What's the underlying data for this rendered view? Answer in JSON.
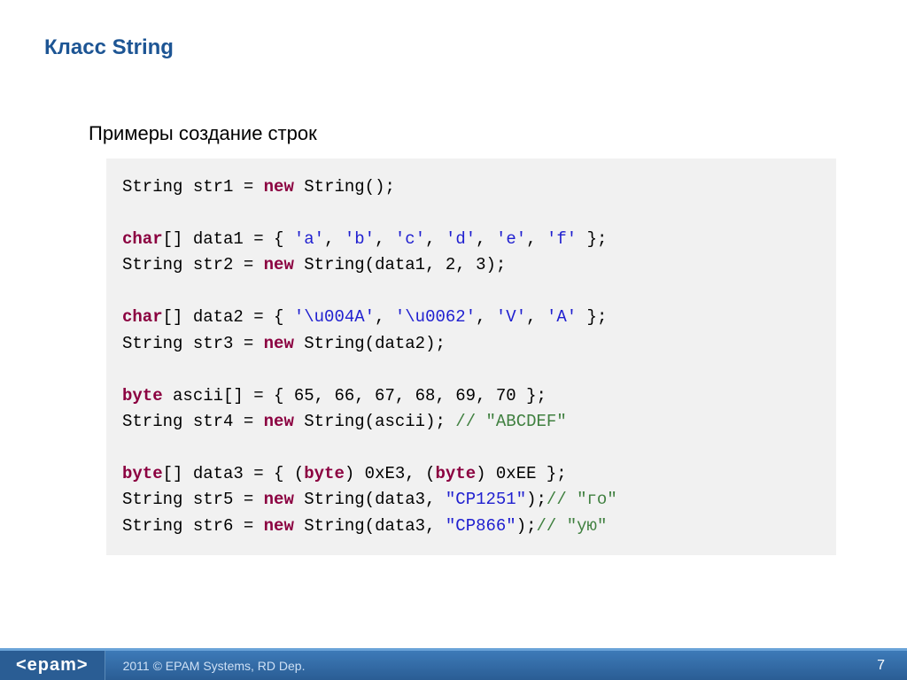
{
  "title": "Класс String",
  "subtitle": "Примеры создание строк",
  "code": {
    "l1_a": "String str1 = ",
    "l1_kw": "new",
    "l1_b": " String();",
    "l2_kw": "char",
    "l2_a": "[] data1 = { ",
    "l2_s1": "'a'",
    "l2_s2": "'b'",
    "l2_s3": "'c'",
    "l2_s4": "'d'",
    "l2_s5": "'e'",
    "l2_s6": "'f'",
    "l2_b": " };",
    "l3_a": "String str2 = ",
    "l3_kw": "new",
    "l3_b": " String(data1, 2, 3);",
    "l4_kw": "char",
    "l4_a": "[] data2 = { ",
    "l4_s1": "'\\u004A'",
    "l4_s2": "'\\u0062'",
    "l4_s3": "'V'",
    "l4_s4": "'A'",
    "l4_b": " };",
    "l5_a": "String str3 = ",
    "l5_kw": "new",
    "l5_b": " String(data2);",
    "l6_kw": "byte",
    "l6_a": " ascii[] = { 65, 66, 67, 68, 69, 70 };",
    "l7_a": "String str4 = ",
    "l7_kw": "new",
    "l7_b": " String(ascii); ",
    "l7_c": "// \"ABCDEF\"",
    "l8_kw": "byte",
    "l8_a": "[] data3 = { (",
    "l8_kw2": "byte",
    "l8_b": ") 0xE3, (",
    "l8_kw3": "byte",
    "l8_c": ") 0xEE };",
    "l9_a": "String str5 = ",
    "l9_kw": "new",
    "l9_b": " String(data3, ",
    "l9_s": "\"CP1251\"",
    "l9_c": ");",
    "l9_cmt": "// \"го\"",
    "l10_a": "String str6 = ",
    "l10_kw": "new",
    "l10_b": " String(data3, ",
    "l10_s": "\"CP866\"",
    "l10_c": ");",
    "l10_cmt": "// \"ую\""
  },
  "footer": {
    "logo": "<epam>",
    "copyright": "2011 © EPAM Systems, RD Dep.",
    "page": "7"
  }
}
